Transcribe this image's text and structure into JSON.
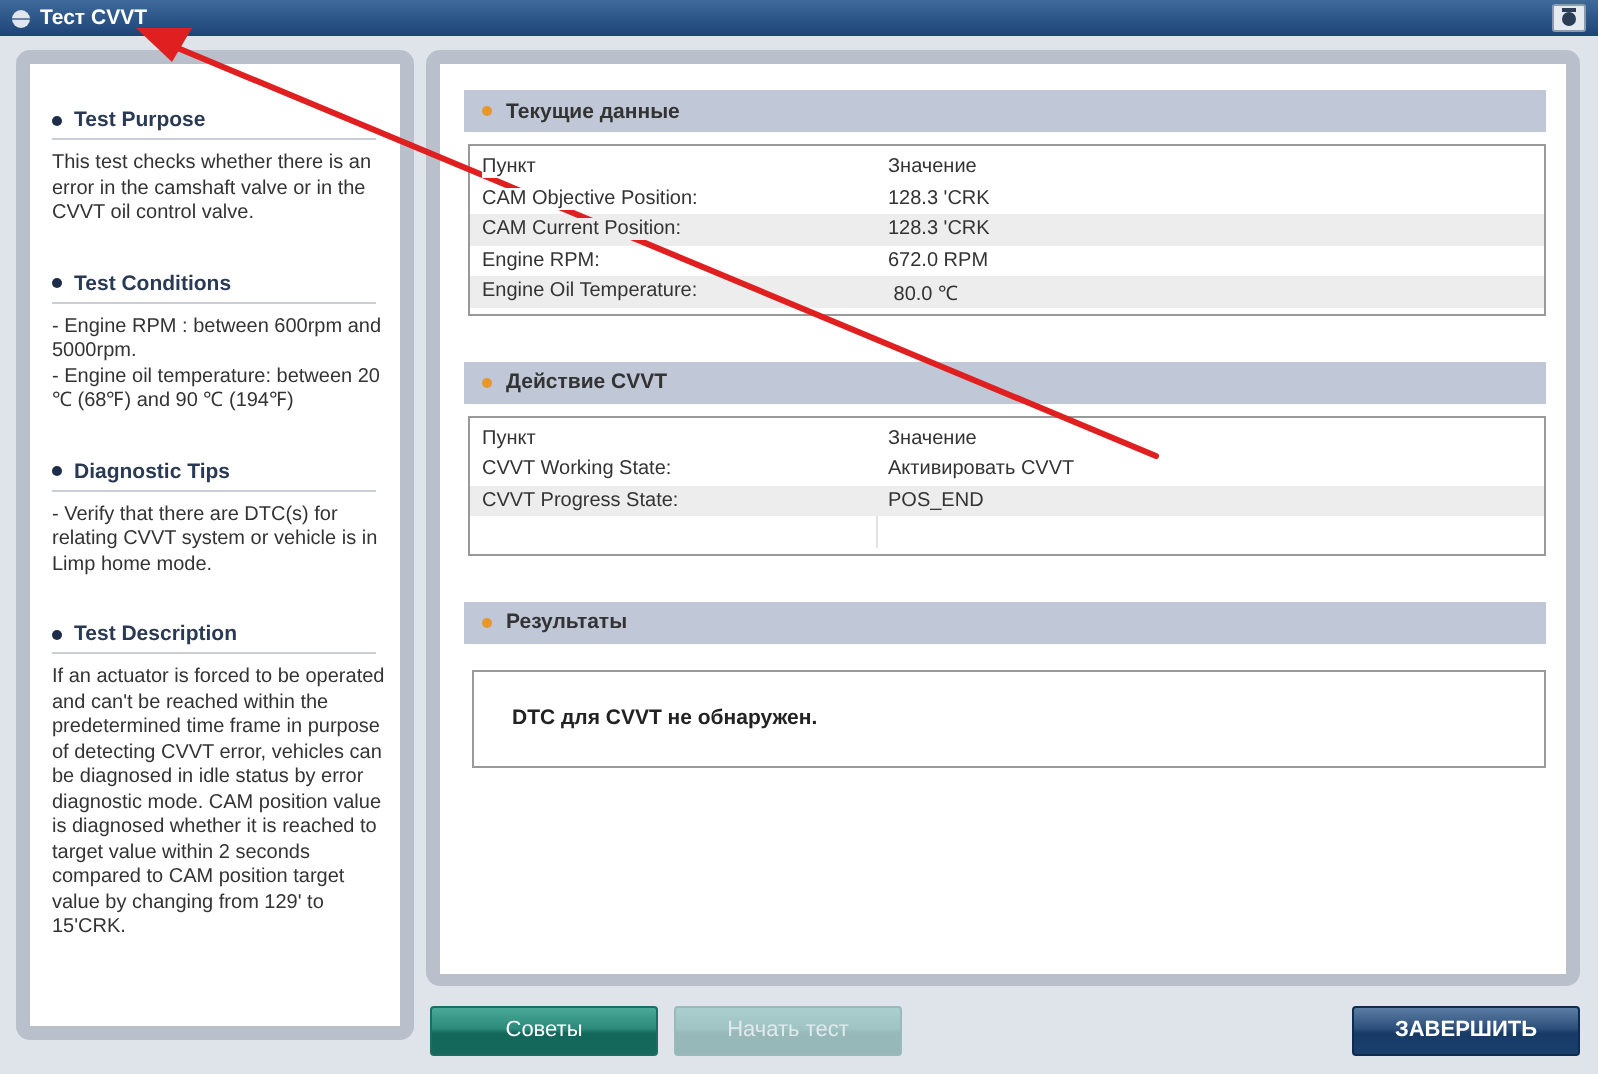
{
  "window": {
    "title": "Тест CVVT"
  },
  "info_sections": [
    {
      "heading": "Test Purpose",
      "text": "This test checks whether there is an error in the camshaft valve or in the CVVT oil control valve."
    },
    {
      "heading": "Test Conditions",
      "text": "- Engine RPM : between 600rpm and 5000rpm.\n- Engine oil temperature: between 20 ℃ (68℉) and 90 ℃ (194℉)"
    },
    {
      "heading": "Diagnostic Tips",
      "text": "- Verify that there are DTC(s) for relating CVVT system or vehicle is in Limp home mode."
    },
    {
      "heading": "Test Description",
      "text": "If an actuator is forced to be operated and can't be reached within the predetermined time frame in purpose of detecting CVVT error, vehicles can be diagnosed in idle status by error diagnostic mode. CAM position value is diagnosed whether it is reached to target value within 2 seconds compared to CAM position target value by changing from 129' to 15'CRK."
    }
  ],
  "tables": [
    {
      "title": "Текущие данные",
      "columns": [
        "Пункт",
        "Значение"
      ],
      "blank_row": false,
      "rows": [
        [
          "CAM Objective Position:",
          "128.3 'CRK"
        ],
        [
          "CAM Current Position:",
          "128.3 'CRK"
        ],
        [
          "Engine RPM:",
          "672.0 RPM"
        ],
        [
          "Engine Oil Temperature:",
          " 80.0 ℃"
        ]
      ]
    },
    {
      "title": "Действие CVVT",
      "columns": [
        "Пункт",
        "Значение"
      ],
      "blank_row": true,
      "rows": [
        [
          "CVVT Working State:",
          "Активировать CVVT"
        ],
        [
          "CVVT Progress State:",
          "POS_END"
        ]
      ]
    }
  ],
  "results": {
    "title": "Результаты",
    "message": "DTC для CVVT не обнаружен."
  },
  "buttons": [
    {
      "label": "Советы",
      "kind": "teal",
      "disabled": false
    },
    {
      "label": "Начать тест",
      "kind": "teal",
      "disabled": true
    },
    {
      "label": "ЗАВЕРШИТЬ",
      "kind": "navy",
      "disabled": false
    }
  ]
}
